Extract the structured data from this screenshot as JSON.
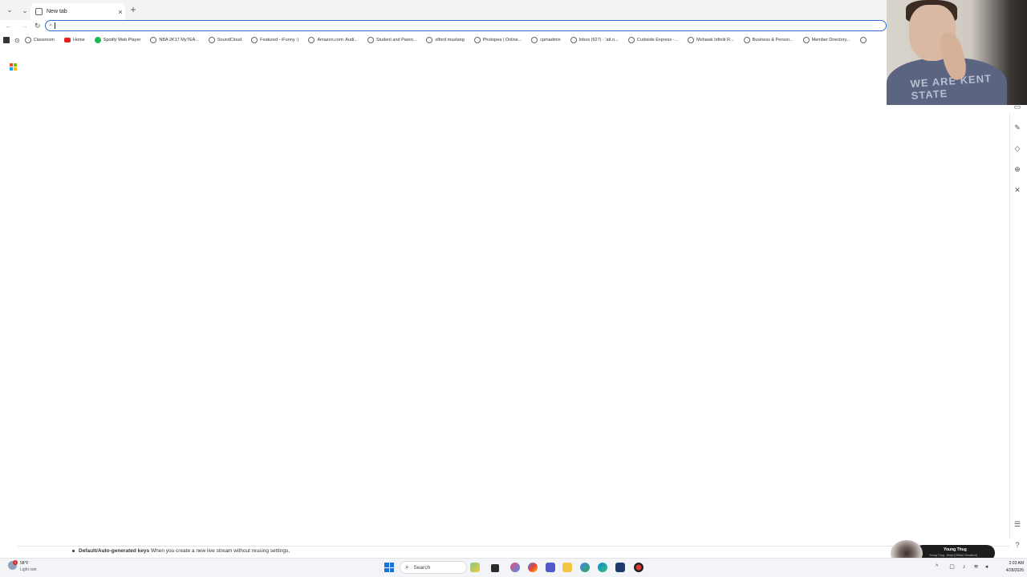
{
  "browser": {
    "active_tab": {
      "title": "New tab",
      "close": "×"
    },
    "new_tab": "+",
    "nav": {
      "back": "←",
      "forward": "→",
      "reload": "↻"
    },
    "address": {
      "value": "",
      "placeholder": ""
    }
  },
  "bookmarks": [
    {
      "label": "Classroom",
      "icon": "globe-icon"
    },
    {
      "label": "Home",
      "icon": "youtube-icon"
    },
    {
      "label": "Spotify Web Player",
      "icon": "spotify-icon"
    },
    {
      "label": "NBA 2K17 MyTEA...",
      "icon": "globe-icon"
    },
    {
      "label": "SoundCloud",
      "icon": "globe-icon"
    },
    {
      "label": "Featured - iFunny :)",
      "icon": "globe-icon"
    },
    {
      "label": "Amazon.com: Audi...",
      "icon": "globe-icon"
    },
    {
      "label": "Student and Paren...",
      "icon": "globe-icon"
    },
    {
      "label": "olford mustang",
      "icon": "globe-icon"
    },
    {
      "label": "Photopea | Online...",
      "icon": "globe-icon"
    },
    {
      "label": "cpmadmin",
      "icon": "globe-icon"
    },
    {
      "label": "Inbox (627) - 'att.n...",
      "icon": "globe-icon"
    },
    {
      "label": "Curbside Express -...",
      "icon": "globe-icon"
    },
    {
      "label": "Mohawk Infiniti R...",
      "icon": "globe-icon"
    },
    {
      "label": "Business & Person...",
      "icon": "globe-icon"
    },
    {
      "label": "Member Directory...",
      "icon": "globe-icon"
    }
  ],
  "webcam": {
    "shirt_text": "WE ARE KENT STATE"
  },
  "notification": {
    "title": "Default/Auto-generated keys",
    "text": "When you create a new live stream without reusing settings,"
  },
  "now_playing": {
    "artist": "Young Thug",
    "song": "Young Thug - Ways [Official Visualizer]"
  },
  "taskbar": {
    "weather_temp": "58°F",
    "weather_desc": "Light rain",
    "weather_badge": "1",
    "search_label": "Search",
    "time": "2:03 AM",
    "date": "4/28/2026"
  },
  "colors": {
    "accent": "#2f6fd0",
    "start": "#1c74d8",
    "youtube": "#e52020",
    "spotify": "#1db954"
  }
}
